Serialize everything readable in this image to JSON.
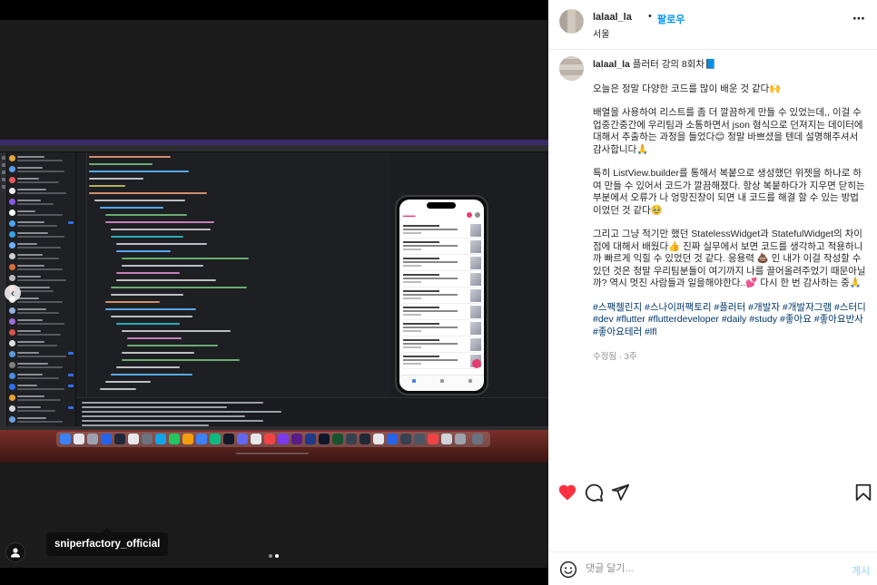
{
  "post": {
    "author": "lalaal_la",
    "dot": "•",
    "follow_label": "팔로우",
    "location": "서울",
    "more_glyph": "⋯"
  },
  "caption": {
    "author": "lalaal_la",
    "title": "플러터 강의 8회차📘",
    "p1": "오늘은 정말 다양한 코드를 많이 배운 것 같다🙌",
    "p2": "배열을 사용하여 리스트를 좀 더 깔끔하게 만들 수 있었는데,, 이걸 수업중간중간에 우리팀과 소통하면서 json 형식으로 던져지는 데이터에 대해서 추출하는 과정을 들었다😊 정말 바쁘셨을 텐데 설명해주셔서 감사합니다🙏",
    "p3": "특히 ListView.builder를 통해서 복붙으로 생성했던 위젯을 하나로 하여 만들 수 있어서 코드가 깔끔해졌다. 항상 복붙하다가 지우면 닫히는 부분에서 오류가 나 엉망진창이 되면 내 코드를 해결 할 수 있는 방법이었던 것 같다🥹",
    "p4": "그리고 그냥 적기만 했던 StatelessWidget과 StatefulWidget의 차이점에 대해서 배웠다👍 진짜 실무에서 보면 코드를 생각하고 적용하니까 빠르게 익힐 수 있었던 것 같다. 응용력 💩 인 내가 이걸 작성할 수 있던 것은 정말 우리팀분들이 여기까지 나를 끌어올려주었기 때문아닐까? 역시 멋진 사람들과 일을해야한다..💕 다시 한 번 감사하는 중🙏",
    "hashtags": "#스팩첼린지 #스나이퍼팩토리 #플러터 #개발자 #개발자그램 #스터디 #dev #flutter #flutterdeveloper #daily #study #좋아요 #좋아요반사 #좋아요테러 #lfl",
    "meta": "수정됨 · 3주"
  },
  "media": {
    "tagged_user": "sniperfactory_official",
    "nav_prev_glyph": "‹",
    "page_index": 2,
    "page_count": 2
  },
  "comment": {
    "placeholder": "댓글 달기...",
    "post_label": "게시"
  },
  "colors": {
    "like_red": "#ff3040",
    "link_blue": "#0095f6",
    "hashtag_navy": "#00376b",
    "muted": "#8e8e8e"
  },
  "icons": [
    "heart-icon",
    "comment-icon",
    "share-icon",
    "bookmark-icon",
    "emoji-icon",
    "user-icon",
    "more-icon"
  ]
}
